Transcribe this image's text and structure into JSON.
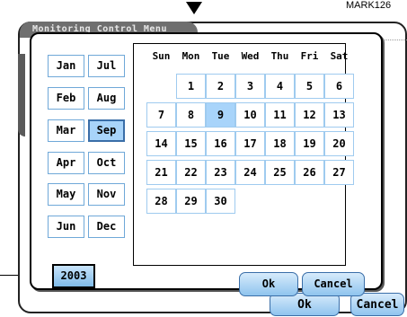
{
  "annotation": {
    "mark_label": "MARK126"
  },
  "background_window": {
    "title": "Monitoring Control Menu",
    "partial_letter": "S",
    "ok_label": "Ok",
    "cancel_label": "Cancel"
  },
  "dialog": {
    "months_left": [
      "Jan",
      "Feb",
      "Mar",
      "Apr",
      "May",
      "Jun"
    ],
    "months_right": [
      "Jul",
      "Aug",
      "Sep",
      "Oct",
      "Nov",
      "Dec"
    ],
    "selected_month": "Sep",
    "year": "2003",
    "weekdays": [
      "Sun",
      "Mon",
      "Tue",
      "Wed",
      "Thu",
      "Fri",
      "Sat"
    ],
    "days": [
      [
        "",
        "1",
        "2",
        "3",
        "4",
        "5",
        "6"
      ],
      [
        "7",
        "8",
        "9",
        "10",
        "11",
        "12",
        "13"
      ],
      [
        "14",
        "15",
        "16",
        "17",
        "18",
        "19",
        "20"
      ],
      [
        "21",
        "22",
        "23",
        "24",
        "25",
        "26",
        "27"
      ],
      [
        "28",
        "29",
        "30",
        "",
        "",
        "",
        ""
      ]
    ],
    "selected_day": "9",
    "ok_label": "Ok",
    "cancel_label": "Cancel"
  },
  "colors": {
    "selected": "#a8d4fa",
    "button_border": "#3a6ea8",
    "cell_border": "#9fcbef"
  }
}
